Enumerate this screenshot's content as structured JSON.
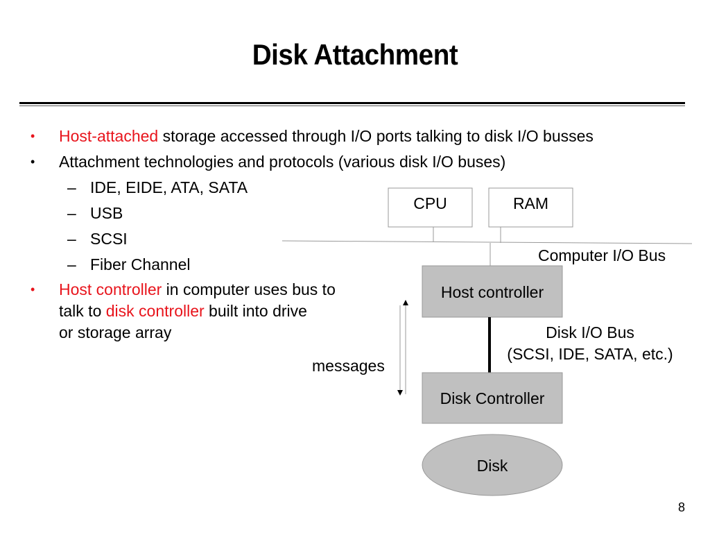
{
  "slide": {
    "title": "Disk Attachment",
    "page_number": "8",
    "accent_color": "#e8141c"
  },
  "bullets": [
    {
      "level": 1,
      "bullet_color": "#e8141c",
      "parts": [
        {
          "text": "Host-attached",
          "highlight": true
        },
        {
          "text": " storage accessed through I/O ports talking to disk I/O busses",
          "highlight": false
        }
      ]
    },
    {
      "level": 1,
      "parts": [
        {
          "text": "Attachment technologies and protocols (various disk I/O buses)",
          "highlight": false
        }
      ]
    },
    {
      "level": 2,
      "text": "IDE, EIDE, ATA, SATA"
    },
    {
      "level": 2,
      "text": "USB"
    },
    {
      "level": 2,
      "text": "SCSI"
    },
    {
      "level": 2,
      "text": "Fiber Channel"
    },
    {
      "level": 1,
      "bullet_color": "#e8141c",
      "lines": [
        [
          {
            "text": "Host controller",
            "highlight": true
          },
          {
            "text": " in computer uses bus to",
            "highlight": false
          }
        ],
        [
          {
            "text": "talk to ",
            "highlight": false
          },
          {
            "text": "disk controller",
            "highlight": true
          },
          {
            "text": " built into drive",
            "highlight": false
          }
        ],
        [
          {
            "text": "or storage array",
            "highlight": false
          }
        ]
      ]
    }
  ],
  "bullet_glyph": "•",
  "dash_glyph": "–",
  "diagram": {
    "cpu_label": "CPU",
    "ram_label": "RAM",
    "computer_bus_label": "Computer I/O Bus",
    "host_controller_label": "Host controller",
    "disk_bus_label_line1": "Disk I/O Bus",
    "disk_bus_label_line2": "(SCSI, IDE, SATA, etc.)",
    "messages_label": "messages",
    "disk_controller_label": "Disk Controller",
    "disk_label": "Disk",
    "box_fill": "#c0c0c0",
    "box_border": "#999999"
  }
}
